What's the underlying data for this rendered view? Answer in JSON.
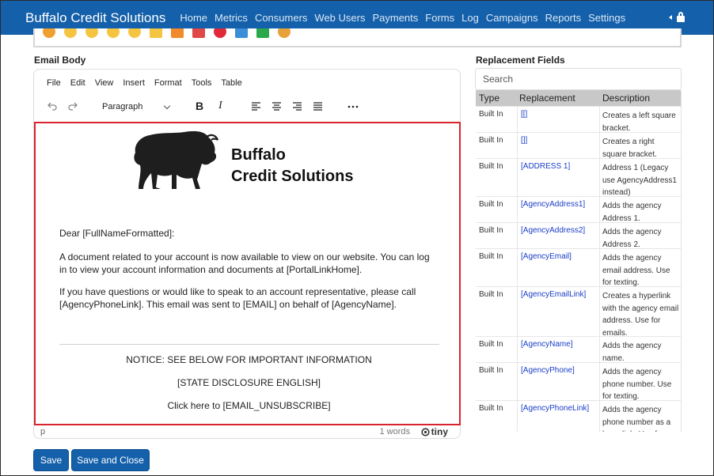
{
  "nav": {
    "brand": "Buffalo Credit Solutions",
    "links": [
      "Home",
      "Metrics",
      "Consumers",
      "Web Users",
      "Payments",
      "Forms",
      "Log",
      "Campaigns",
      "Reports",
      "Settings"
    ]
  },
  "editor": {
    "section_label": "Email Body",
    "menu": [
      "File",
      "Edit",
      "View",
      "Insert",
      "Format",
      "Tools",
      "Table"
    ],
    "block_format": "Paragraph",
    "logo_line1": "Buffalo",
    "logo_line2": "Credit Solutions",
    "salutation": "Dear [FullNameFormatted]:",
    "paragraph1": "A document related to your account is now available to view on our website. You can log in to view your account information and documents at [PortalLinkHome].",
    "paragraph2": "If you have questions or would like to speak to an account representative, please call [AgencyPhoneLink].  This email was sent to [EMAIL] on behalf of [AgencyName].",
    "notice": "NOTICE: SEE BELOW FOR IMPORTANT INFORMATION",
    "disclosure": "[STATE DISCLOSURE ENGLISH]",
    "unsubscribe": "Click here to [EMAIL_UNSUBSCRIBE]",
    "status_path": "p",
    "word_count": "1 words",
    "tiny_label": "tiny"
  },
  "actions": {
    "save": "Save",
    "save_close": "Save and Close"
  },
  "replacement": {
    "section_label": "Replacement Fields",
    "search_placeholder": "Search",
    "headers": [
      "Type",
      "Replacement",
      "Description"
    ],
    "rows": [
      {
        "type": "Built In",
        "replacement": "[[]",
        "description": "Creates a left square bracket."
      },
      {
        "type": "Built In",
        "replacement": "[]]",
        "description": "Creates a right square bracket."
      },
      {
        "type": "Built In",
        "replacement": "[ADDRESS 1]",
        "description": "Address 1 (Legacy use AgencyAddress1 instead)"
      },
      {
        "type": "Built In",
        "replacement": "[AgencyAddress1]",
        "description": "Adds the agency Address 1."
      },
      {
        "type": "Built In",
        "replacement": "[AgencyAddress2]",
        "description": "Adds the agency Address 2."
      },
      {
        "type": "Built In",
        "replacement": "[AgencyEmail]",
        "description": "Adds the agency email address. Use for texting."
      },
      {
        "type": "Built In",
        "replacement": "[AgencyEmailLink]",
        "description": "Creates a hyperlink with the agency email address. Use for emails."
      },
      {
        "type": "Built In",
        "replacement": "[AgencyName]",
        "description": "Adds the agency name."
      },
      {
        "type": "Built In",
        "replacement": "[AgencyPhone]",
        "description": "Adds the agency phone number. Use for texting."
      },
      {
        "type": "Built In",
        "replacement": "[AgencyPhoneLink]",
        "description": "Adds the agency phone number as a hyperlink. Use for emails."
      }
    ]
  },
  "colors": {
    "nav_bg": "#1460aa",
    "highlight_border": "#d9232d",
    "link_blue": "#1a3ec7"
  }
}
